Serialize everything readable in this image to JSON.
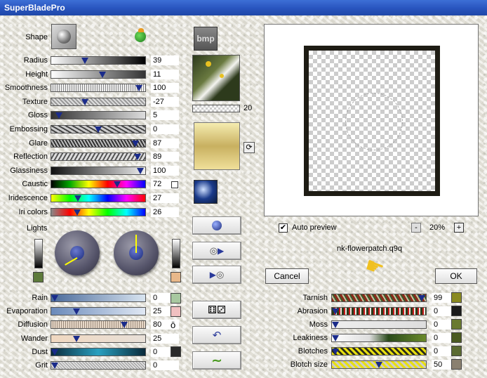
{
  "window": {
    "title": "SuperBladePro"
  },
  "shape": {
    "label": "Shape"
  },
  "sliders_left": [
    {
      "label": "Radius",
      "value": "39"
    },
    {
      "label": "Height",
      "value": "11"
    },
    {
      "label": "Smoothness",
      "value": "100"
    },
    {
      "label": "Texture",
      "value": "-27"
    },
    {
      "label": "Gloss",
      "value": "5"
    },
    {
      "label": "Embossing",
      "value": "0"
    },
    {
      "label": "Glare",
      "value": "87"
    },
    {
      "label": "Reflection",
      "value": "89"
    },
    {
      "label": "Glassiness",
      "value": "100"
    },
    {
      "label": "Caustic",
      "value": "72"
    },
    {
      "label": "Iridescence",
      "value": "27"
    },
    {
      "label": "Iri colors",
      "value": "26"
    }
  ],
  "lights": {
    "label": "Lights"
  },
  "sliders_bottom_left": [
    {
      "label": "Rain",
      "value": "0"
    },
    {
      "label": "Evaporation",
      "value": "25"
    },
    {
      "label": "Diffusion",
      "value": "80"
    },
    {
      "label": "Wander",
      "value": "25"
    },
    {
      "label": "Dust",
      "value": "0"
    },
    {
      "label": "Grit",
      "value": "0"
    }
  ],
  "texture": {
    "bmp_label": "bmp",
    "scale_value": "20"
  },
  "preview": {
    "auto_preview_label": "Auto preview",
    "zoom": "20%",
    "zoom_minus": "-",
    "zoom_plus": "+"
  },
  "preset": {
    "name": "nk-flowerpatch.q9q"
  },
  "buttons": {
    "cancel": "Cancel",
    "ok": "OK"
  },
  "sliders_right": [
    {
      "label": "Tarnish",
      "value": "99"
    },
    {
      "label": "Abrasion",
      "value": "0"
    },
    {
      "label": "Moss",
      "value": "0"
    },
    {
      "label": "Leakiness",
      "value": "0"
    },
    {
      "label": "Blotches",
      "value": "0"
    },
    {
      "label": "Blotch size",
      "value": "50"
    }
  ],
  "colors": {
    "light_left": "#5d7a3a",
    "light_right": "#e8b88a",
    "rain": "#a8c8a0",
    "evaporation": "#f0c0c0",
    "dust": "#2a2a2a",
    "tarnish": "#8a8a20",
    "abrasion": "#1a1a1a",
    "moss": "#6a7a30",
    "leakiness": "#4a5a20",
    "blotches": "#5a6a30",
    "blotch_size": "#8a8070"
  }
}
